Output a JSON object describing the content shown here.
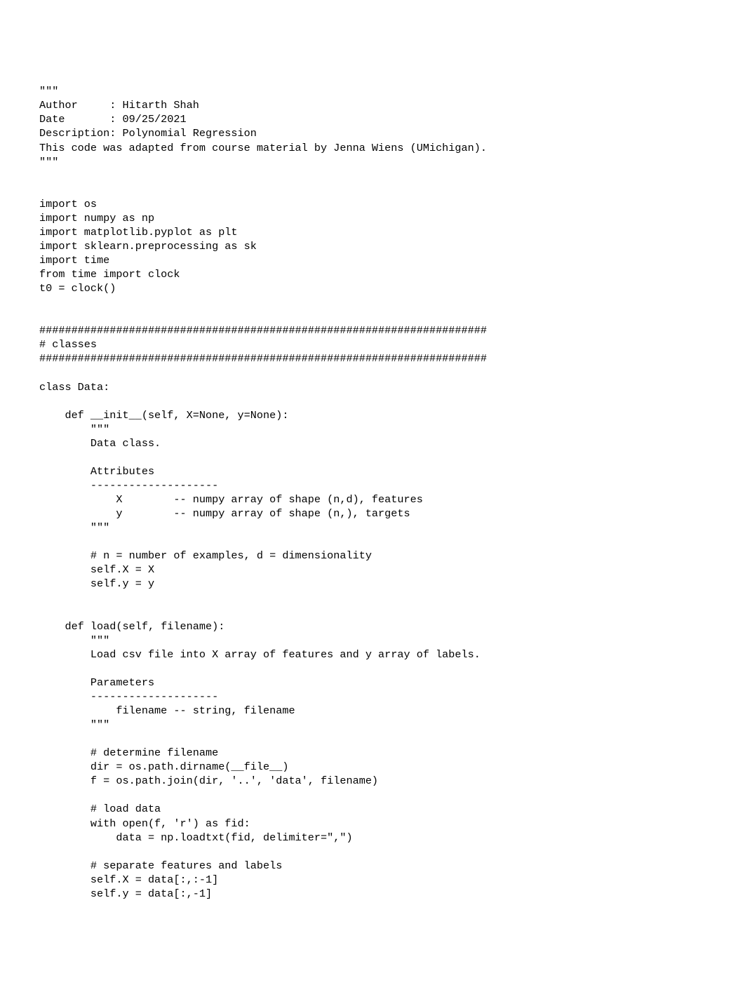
{
  "lines": [
    "\"\"\"",
    "Author     : Hitarth Shah",
    "Date       : 09/25/2021",
    "Description: Polynomial Regression",
    "This code was adapted from course material by Jenna Wiens (UMichigan).",
    "\"\"\"",
    "",
    "",
    "import os",
    "import numpy as np",
    "import matplotlib.pyplot as plt",
    "import sklearn.preprocessing as sk",
    "import time",
    "from time import clock",
    "t0 = clock()",
    "",
    "",
    "######################################################################",
    "# classes",
    "######################################################################",
    "",
    "class Data:",
    "",
    "    def __init__(self, X=None, y=None):",
    "        \"\"\"",
    "        Data class.",
    "",
    "        Attributes",
    "        --------------------",
    "            X        -- numpy array of shape (n,d), features",
    "            y        -- numpy array of shape (n,), targets",
    "        \"\"\"",
    "",
    "        # n = number of examples, d = dimensionality",
    "        self.X = X",
    "        self.y = y",
    "",
    "",
    "    def load(self, filename):",
    "        \"\"\"",
    "        Load csv file into X array of features and y array of labels.",
    "",
    "        Parameters",
    "        --------------------",
    "            filename -- string, filename",
    "        \"\"\"",
    "",
    "        # determine filename",
    "        dir = os.path.dirname(__file__)",
    "        f = os.path.join(dir, '..', 'data', filename)",
    "",
    "        # load data",
    "        with open(f, 'r') as fid:",
    "            data = np.loadtxt(fid, delimiter=\",\")",
    "",
    "        # separate features and labels",
    "        self.X = data[:,:-1]",
    "        self.y = data[:,-1]"
  ]
}
